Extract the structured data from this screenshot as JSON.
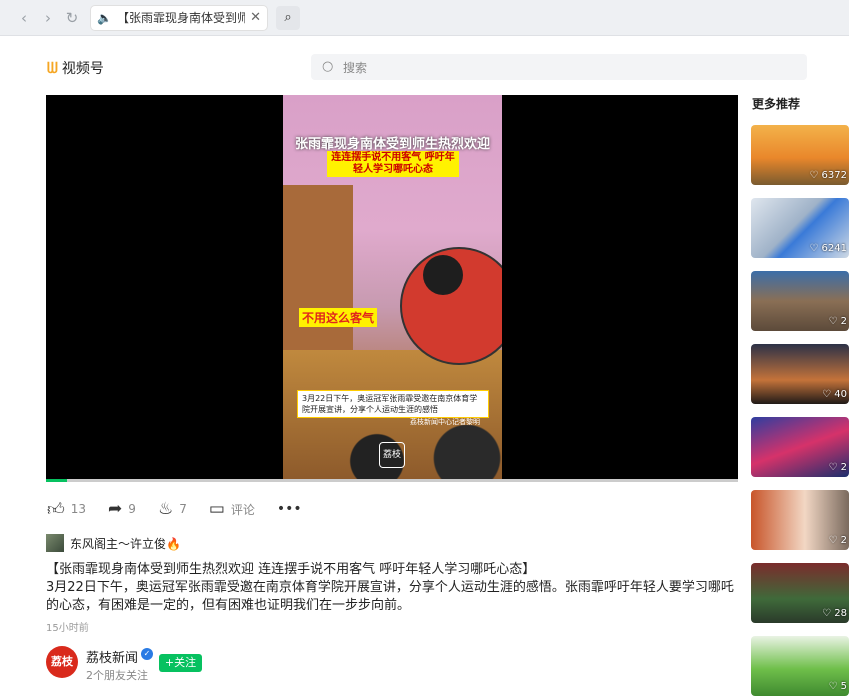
{
  "tab": {
    "title": "【张雨霏现身南体受到师生热烈欢迎"
  },
  "header": {
    "logo_text": "视频号",
    "search_placeholder": "搜索"
  },
  "video_captions": {
    "title": "张雨霏现身南体受到师生热烈欢迎",
    "sub": "连连摆手说不用客气 呼吁年轻人学习哪吒心态",
    "quote": "不用这么客气",
    "info": "3月22日下午，奥运冠军张雨霏受邀在南京体育学院开展宣讲，分享个人运动生涯的感悟",
    "credit": "荔枝新闻中心记者黎明",
    "watermark": "荔枝"
  },
  "progress": {
    "percent": 3
  },
  "actions": {
    "likes": "13",
    "shares": "9",
    "fire": "7",
    "comment_label": "评论",
    "more": "•••"
  },
  "author": {
    "name": "东风阁主～许立俊🔥"
  },
  "description": {
    "title": "【张雨霏现身南体受到师生热烈欢迎 连连摆手说不用客气  呼吁年轻人学习哪吒心态】",
    "body": "3月22日下午，奥运冠军张雨霏受邀在南京体育学院开展宣讲，分享个人运动生涯的感悟。张雨霏呼吁年轻人要学习哪吒的心态，有困难是一定的，但有困难也证明我们在一步步向前。",
    "time": "15小时前"
  },
  "channel": {
    "avatar_text": "荔枝",
    "name": "荔枝新闻",
    "follow": "+关注",
    "friends": "2个朋友关注"
  },
  "sidebar": {
    "title": "更多推荐",
    "items": [
      {
        "count": "♡ 6372"
      },
      {
        "count": "♡ 6241"
      },
      {
        "count": "♡ 2"
      },
      {
        "count": "♡ 40"
      },
      {
        "count": "♡ 2"
      },
      {
        "count": "♡ 2"
      },
      {
        "count": "♡ 28"
      },
      {
        "count": "♡ 5"
      }
    ]
  }
}
